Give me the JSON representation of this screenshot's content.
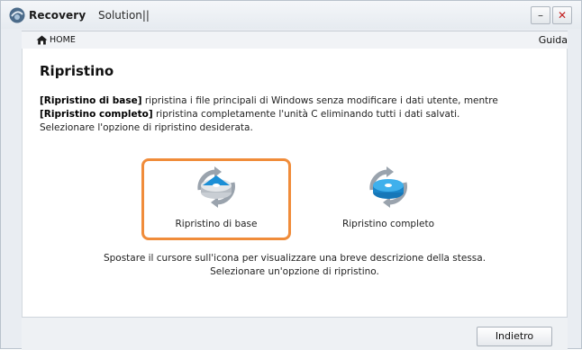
{
  "window": {
    "title_bold": "Recovery",
    "title_light": "Solution||",
    "minimize_label": "–",
    "close_label": "✕"
  },
  "toolbar": {
    "home_label": "HOME",
    "help_label": "Guida"
  },
  "page": {
    "title": "Ripristino",
    "desc_line1_bold": "[Ripristino di base]",
    "desc_line1_rest": " ripristina i file principali di Windows senza modificare i dati utente, mentre",
    "desc_line2_bold": "[Ripristino completo]",
    "desc_line2_rest": " ripristina completamente l'unità C eliminando tutti i dati salvati.",
    "desc_line3": "Selezionare l'opzione di ripristino desiderata."
  },
  "options": [
    {
      "label": "Ripristino di base",
      "icon": "disk-restore-icon",
      "selected": true
    },
    {
      "label": "Ripristino completo",
      "icon": "disk-full-restore-icon",
      "selected": false
    }
  ],
  "hint": {
    "line1": "Spostare il cursore sull'icona per visualizzare una breve descrizione della stessa.",
    "line2": "Selezionare un'opzione di ripristino."
  },
  "footer": {
    "back_label": "Indietro"
  },
  "colors": {
    "selection_border": "#f08c3a",
    "close_x": "#c21d1d",
    "disk_blue": "#1c8fd6"
  }
}
